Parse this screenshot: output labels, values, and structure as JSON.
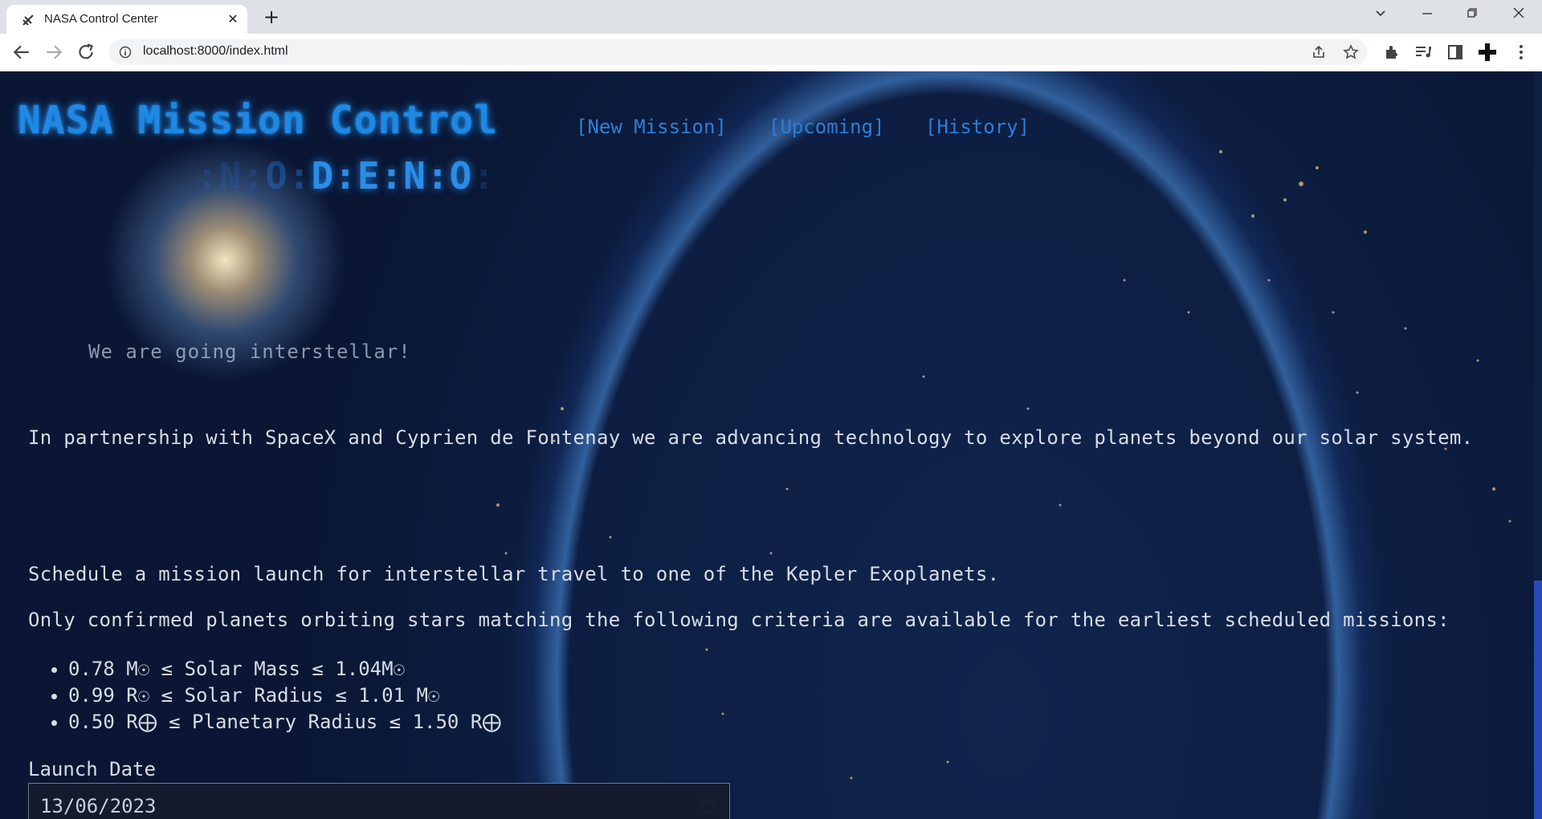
{
  "browser": {
    "tab_title": "NASA Control Center",
    "url": "localhost:8000/index.html"
  },
  "page": {
    "app_title": "NASA Mission Control",
    "logo_letters": ":N:O:D:E:N:O:",
    "nav": [
      "[New Mission]",
      "[Upcoming]",
      "[History]"
    ],
    "tagline": "We are going interstellar!",
    "intro": "In partnership with SpaceX and Cyprien de Fontenay we are advancing technology to explore planets beyond our solar system.",
    "schedule_text": "Schedule a mission launch for interstellar travel to one of the Kepler Exoplanets.",
    "criteria_intro": "Only confirmed planets orbiting stars matching the following criteria are available for the earliest scheduled missions:",
    "criteria": [
      "0.78 M☉ ≤ Solar Mass ≤ 1.04M☉",
      "0.99 R☉ ≤ Solar Radius ≤ 1.01 M☉",
      "0.50 R⨁ ≤ Planetary Radius ≤ 1.50 R⨁"
    ],
    "launch_date_label": "Launch Date",
    "launch_date_value": "13/06/2023"
  },
  "colors": {
    "accent": "#1e88e5",
    "nav_link": "#2b7fd9",
    "body_text": "#d7dde7",
    "background": "#0b1a3a"
  },
  "icons": {
    "favicon": "rocket-icon",
    "calendar": "calendar-icon"
  }
}
